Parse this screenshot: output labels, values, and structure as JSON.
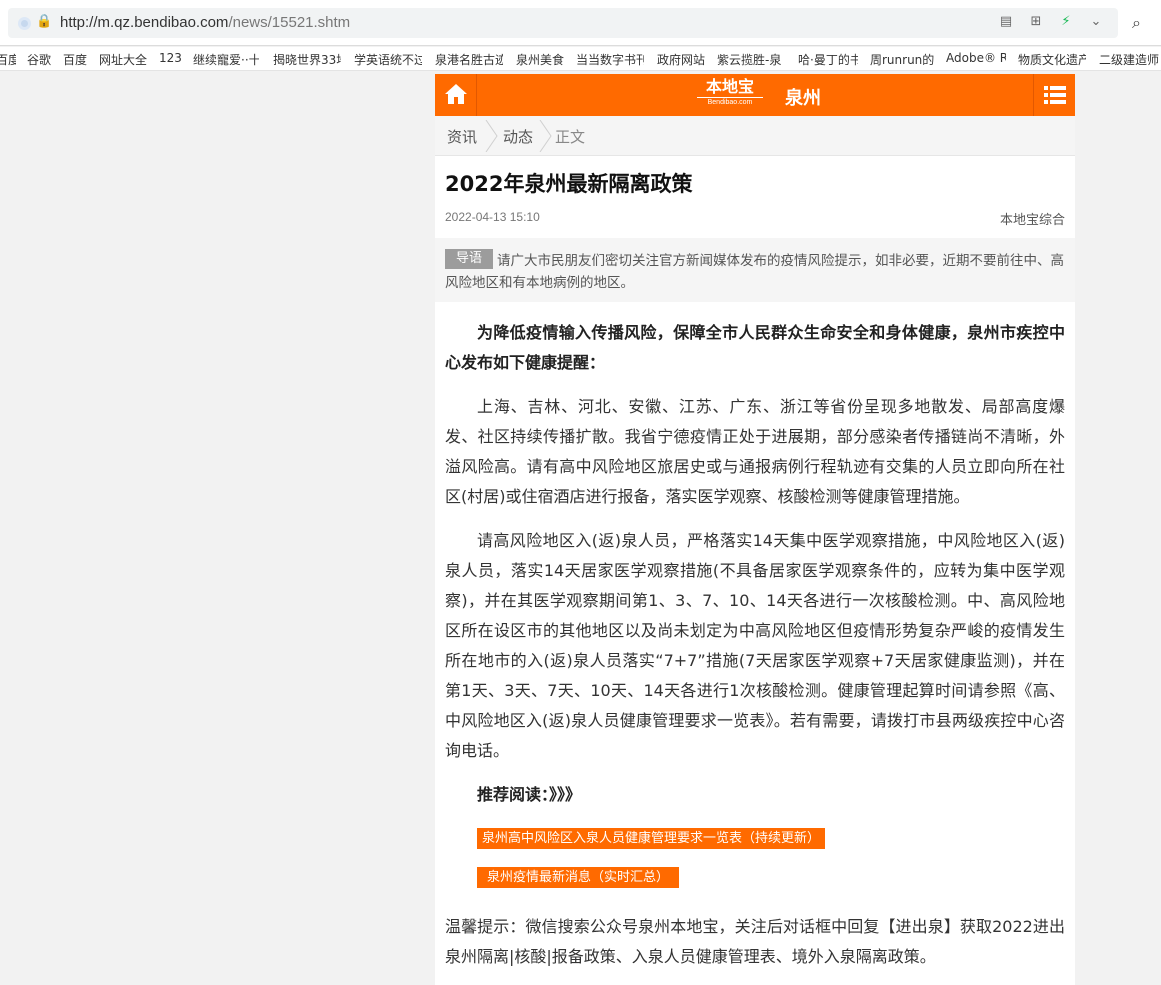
{
  "browser": {
    "url_host": "http://m.qz.bendibao.com",
    "url_path": "/news/15521.shtm",
    "bookmarks": [
      "百度",
      "谷歌",
      "百度",
      "网址大全",
      "123",
      "继续寵爱··十",
      "揭晓世界33地",
      "学英语统不过",
      "泉港名胜古迹",
      "泉州美食",
      "当当数字书刊",
      "政府网站",
      "紫云揽胜-泉",
      "哈·曼丁的书",
      "周runrun的",
      "Adobe® R",
      "物质文化遗产",
      "二级建造师"
    ]
  },
  "header": {
    "logo_cn": "本地宝",
    "logo_en": "Bendibao.com",
    "city": "泉州"
  },
  "breadcrumb": {
    "items": [
      "资讯",
      "动态",
      "正文"
    ]
  },
  "article": {
    "title": "2022年泉州最新隔离政策",
    "date": "2022-04-13 15:10",
    "source": "本地宝综合",
    "lead_badge": "导语",
    "lead_text": "请广大市民朋友们密切关注官方新闻媒体发布的疫情风险提示，如非必要，近期不要前往中、高风险地区和有本地病例的地区。",
    "paragraphs": [
      "为降低疫情输入传播风险，保障全市人民群众生命安全和身体健康，泉州市疾控中心发布如下健康提醒：",
      "上海、吉林、河北、安徽、江苏、广东、浙江等省份呈现多地散发、局部高度爆发、社区持续传播扩散。我省宁德疫情正处于进展期，部分感染者传播链尚不清晰，外溢风险高。请有高中风险地区旅居史或与通报病例行程轨迹有交集的人员立即向所在社区(村居)或住宿酒店进行报备，落实医学观察、核酸检测等健康管理措施。",
      "请高风险地区入(返)泉人员，严格落实14天集中医学观察措施，中风险地区入(返)泉人员，落实14天居家医学观察措施(不具备居家医学观察条件的，应转为集中医学观察)，并在其医学观察期间第1、3、7、10、14天各进行一次核酸检测。中、高风险地区所在设区市的其他地区以及尚未划定为中高风险地区但疫情形势复杂严峻的疫情发生所在地市的入(返)泉人员落实“7+7”措施(7天居家医学观察+7天居家健康监测)，并在第1天、3天、7天、10天、14天各进行1次核酸检测。健康管理起算时间请参照《高、中风险地区入(返)泉人员健康管理要求一览表》。若有需要，请拨打市县两级疾控中心咨询电话。"
    ],
    "recommend_title": "推荐阅读：》》》",
    "recommend_links": [
      "泉州高中风险区入泉人员健康管理要求一览表（持续更新）",
      "泉州疫情最新消息（实时汇总）"
    ],
    "tip": "温馨提示：微信搜索公众号泉州本地宝，关注后对话框中回复【进出泉】获取2022进出泉州隔离|核酸|报备政策、入泉人员健康管理表、境外入泉隔离政策。"
  },
  "colors": {
    "brand": "#ff6a00",
    "lead_badge": "#9c9c9c"
  }
}
